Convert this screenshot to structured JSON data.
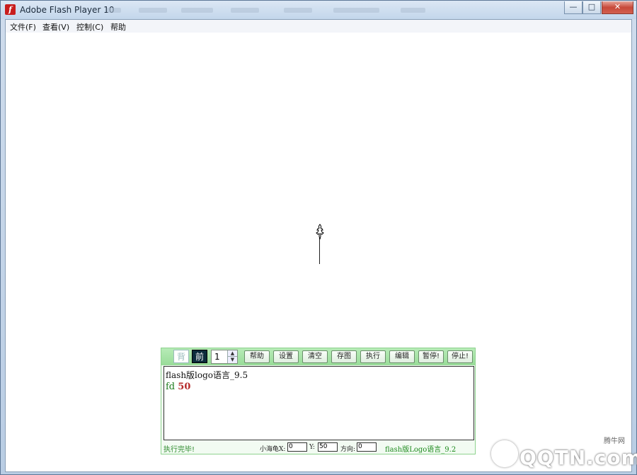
{
  "window": {
    "title": "Adobe Flash Player 10",
    "icon": "flash-icon",
    "controls": {
      "minimize": "—",
      "maximize": "□",
      "close": "✕"
    }
  },
  "menu": [
    {
      "label": "文件(F)"
    },
    {
      "label": "查看(V)"
    },
    {
      "label": "控制(C)"
    },
    {
      "label": "帮助"
    }
  ],
  "panel": {
    "toolbar": {
      "back_label": "背",
      "front_label": "前",
      "spinner_value": "1",
      "buttons": [
        "帮助",
        "设置",
        "清空",
        "存图",
        "执行",
        "编辑",
        "暂停!",
        "停止!"
      ]
    },
    "editor": {
      "line1": "flash版logo语言_9.5",
      "command": "fd",
      "argument": "50"
    },
    "status": {
      "message": "执行完毕!",
      "x_label": "小海龟X:",
      "x_value": "0",
      "y_label": "Y:",
      "y_value": "50",
      "dir_label": "方向:",
      "dir_value": "0",
      "version": "flash版Logo语言_9.2"
    }
  },
  "watermark": {
    "site": "腾牛网",
    "brand": "QQTN.com"
  },
  "colors": {
    "panel_accent": "#98dc98",
    "status_green": "#2d8a2d",
    "number_red": "#b52a2a"
  }
}
